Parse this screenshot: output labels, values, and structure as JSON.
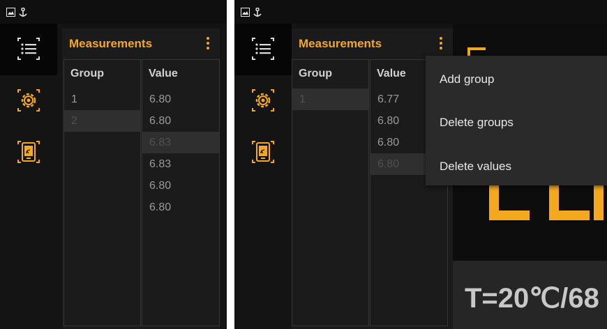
{
  "accent": "#f3a81f",
  "status_icons": [
    "image-icon",
    "anchor-icon"
  ],
  "nav": [
    {
      "name": "list-icon",
      "active": true
    },
    {
      "name": "gear-icon",
      "active": false
    },
    {
      "name": "tablet-wireless-icon",
      "active": false
    }
  ],
  "panel_left": {
    "title": "Measurements",
    "columns": [
      "Group",
      "Value"
    ],
    "groups": [
      "1",
      "2"
    ],
    "values": [
      "6.80",
      "6.80",
      "6.83",
      "6.83",
      "6.80",
      "6.80"
    ]
  },
  "panel_right": {
    "title": "Measurements",
    "columns": [
      "Group",
      "Value"
    ],
    "groups": [
      "1"
    ],
    "values": [
      "6.77",
      "6.80",
      "6.80",
      "6.80"
    ]
  },
  "menu": {
    "items": [
      "Add group",
      "Delete groups",
      "Delete values"
    ]
  },
  "display": {
    "temperature": "T=20℃/68"
  }
}
